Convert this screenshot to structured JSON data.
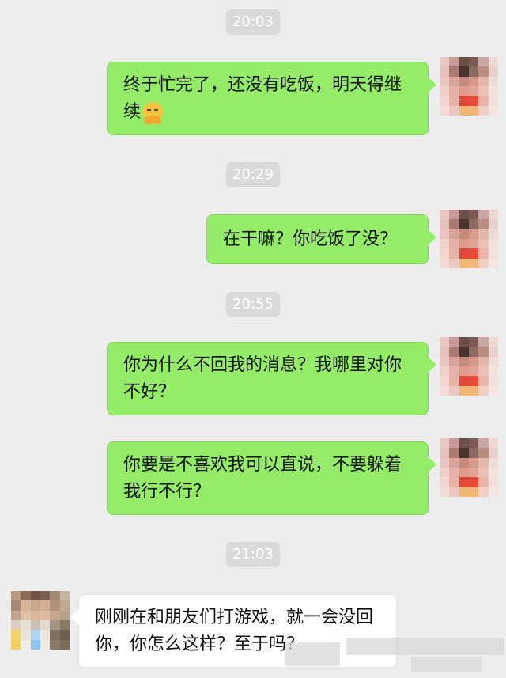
{
  "timestamps": [
    "20:03",
    "20:29",
    "20:55",
    "21:03"
  ],
  "messages": [
    {
      "side": "me",
      "text": "终于忙完了，还没有吃饭，明天得继续",
      "emoji": "hand-over-mouth-emoji"
    },
    {
      "side": "me",
      "text": "在干嘛？你吃饭了没？"
    },
    {
      "side": "me",
      "text": "你为什么不回我的消息？我哪里对你不好？"
    },
    {
      "side": "me",
      "text": "你要是不喜欢我可以直说，不要躲着我行不行？"
    },
    {
      "side": "other",
      "text": "刚刚在和朋友们打游戏，就一会没回你，你怎么这样？至于吗？"
    }
  ],
  "colors": {
    "background": "#ededed",
    "sent_bubble": "#95ec69",
    "received_bubble": "#ffffff",
    "timestamp_bg": "#dadada"
  }
}
